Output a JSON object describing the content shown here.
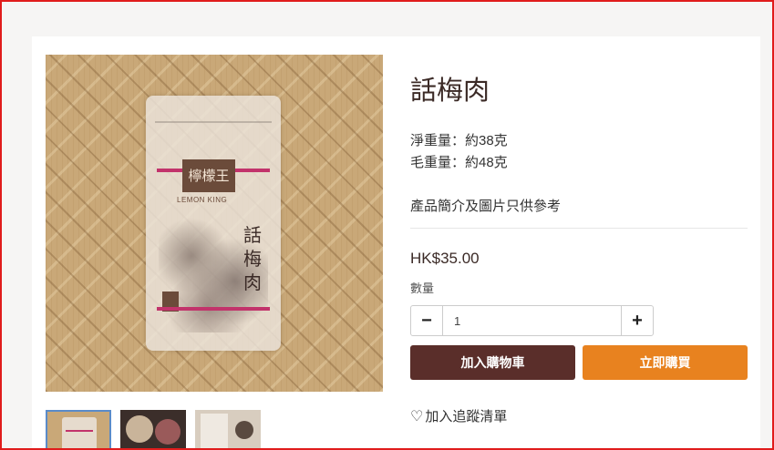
{
  "product": {
    "title": "話梅肉",
    "net_weight": "淨重量：約38克",
    "gross_weight": "毛重量：約48克",
    "note": "產品簡介及圖片只供參考",
    "price": "HK$35.00",
    "qty_label": "數量",
    "qty_value": "1"
  },
  "packaging": {
    "brand": "檸檬王",
    "brand_en": "LEMON KING",
    "name_vertical": "話梅肉"
  },
  "actions": {
    "minus_label": "−",
    "plus_label": "+",
    "add_to_cart": "加入購物車",
    "buy_now": "立即購買",
    "wishlist": "加入追蹤清單"
  },
  "icons": {
    "heart": "heart-outline-icon"
  },
  "colors": {
    "cart_button": "#5a2e2a",
    "buy_button": "#e8821f",
    "thumb_active_border": "#5a8bc9"
  }
}
